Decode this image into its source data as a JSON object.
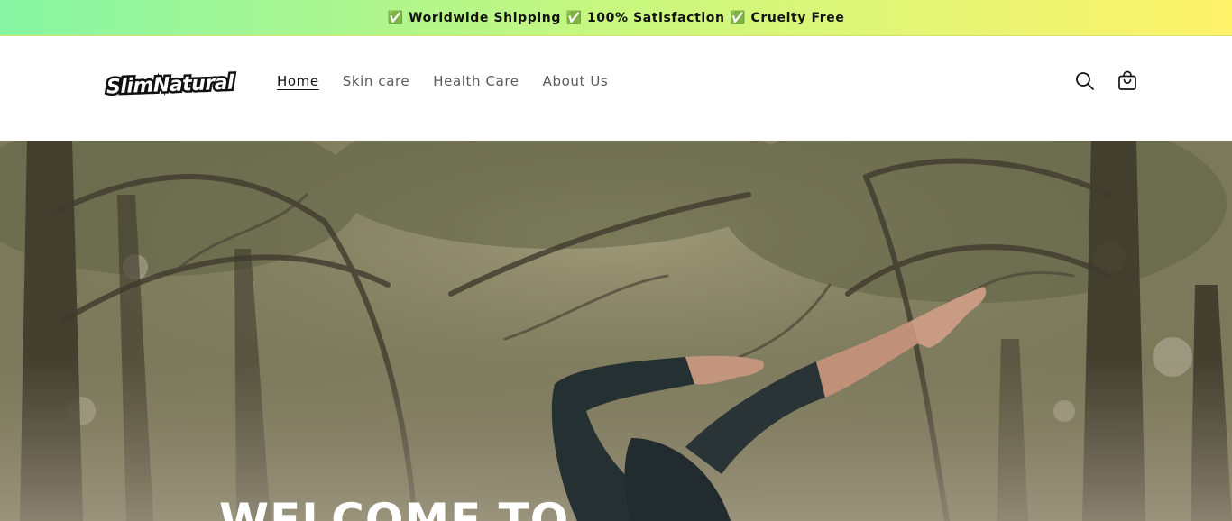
{
  "announcement": {
    "text": "✅ Worldwide Shipping ✅ 100% Satisfaction ✅ Cruelty Free"
  },
  "header": {
    "logo_text": "SlimNatural",
    "nav": [
      {
        "label": "Home",
        "active": true
      },
      {
        "label": "Skin care",
        "active": false
      },
      {
        "label": "Health Care",
        "active": false
      },
      {
        "label": "About Us",
        "active": false
      }
    ],
    "icons": [
      "search-icon",
      "cart-icon"
    ]
  },
  "hero": {
    "heading": "WELCOME TO"
  }
}
